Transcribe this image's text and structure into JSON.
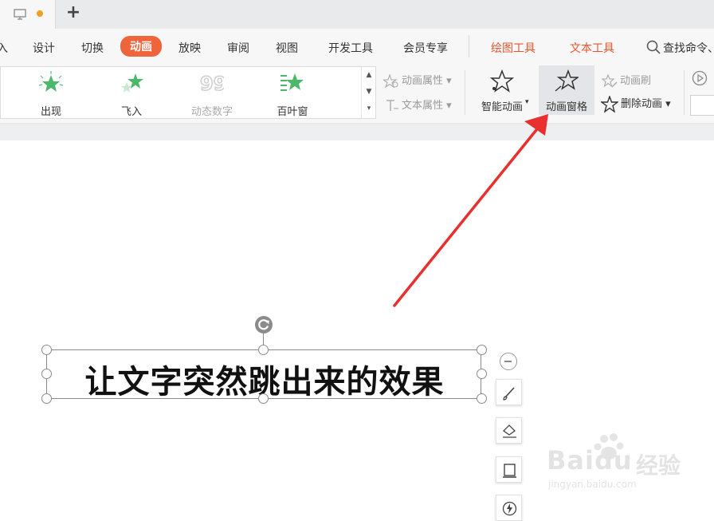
{
  "titlebar": {
    "new_tab_symbol": "+",
    "unsaved_color": "#f0a21e"
  },
  "menu": {
    "items": [
      {
        "label": "入"
      },
      {
        "label": "设计"
      },
      {
        "label": "切换"
      },
      {
        "label": "动画"
      },
      {
        "label": "放映"
      },
      {
        "label": "审阅"
      },
      {
        "label": "视图"
      },
      {
        "label": "开发工具"
      },
      {
        "label": "会员专享"
      },
      {
        "label": "绘图工具"
      },
      {
        "label": "文本工具"
      }
    ],
    "active": "动画",
    "accent_color": "#f0643c",
    "search_label": "查找命令、"
  },
  "gallery": {
    "items": [
      {
        "label": "出现"
      },
      {
        "label": "飞入"
      },
      {
        "label": "动态数字"
      },
      {
        "label": "百叶窗"
      }
    ]
  },
  "ribbon": {
    "animation_properties": "动画属性",
    "text_properties": "文本属性",
    "smart_animation": "智能动画",
    "animation_pane": "动画窗格",
    "animation_painter": "动画刷",
    "delete_animation": "删除动画"
  },
  "slide": {
    "textbox_text": "让文字突然跳出来的效果"
  },
  "watermark": {
    "logo": "Baidu",
    "logo_suffix": "经验",
    "url": "jingyan.baidu.com"
  },
  "annotation": {
    "arrow_color": "#e8302e"
  }
}
